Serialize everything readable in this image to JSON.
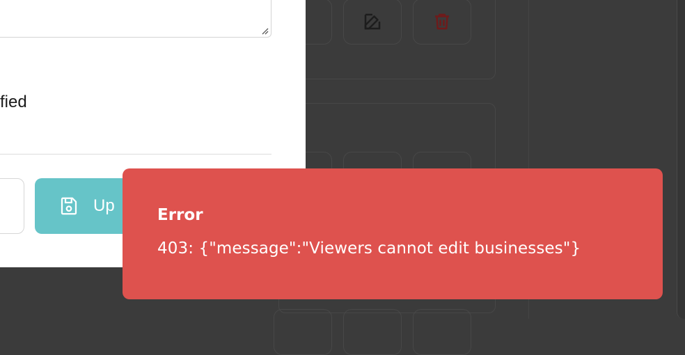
{
  "modal": {
    "verified_fragment": "fied",
    "update_button_label": "Up"
  },
  "toast": {
    "title": "Error",
    "message": "403: {\"message\":\"Viewers cannot edit businesses\"}"
  },
  "colors": {
    "toast_background": "#de524e",
    "update_button": "#66c4c8",
    "delete_icon": "#8b1b1b"
  },
  "icons": {
    "edit": "edit-icon",
    "delete": "trash-icon",
    "save": "save-icon"
  }
}
